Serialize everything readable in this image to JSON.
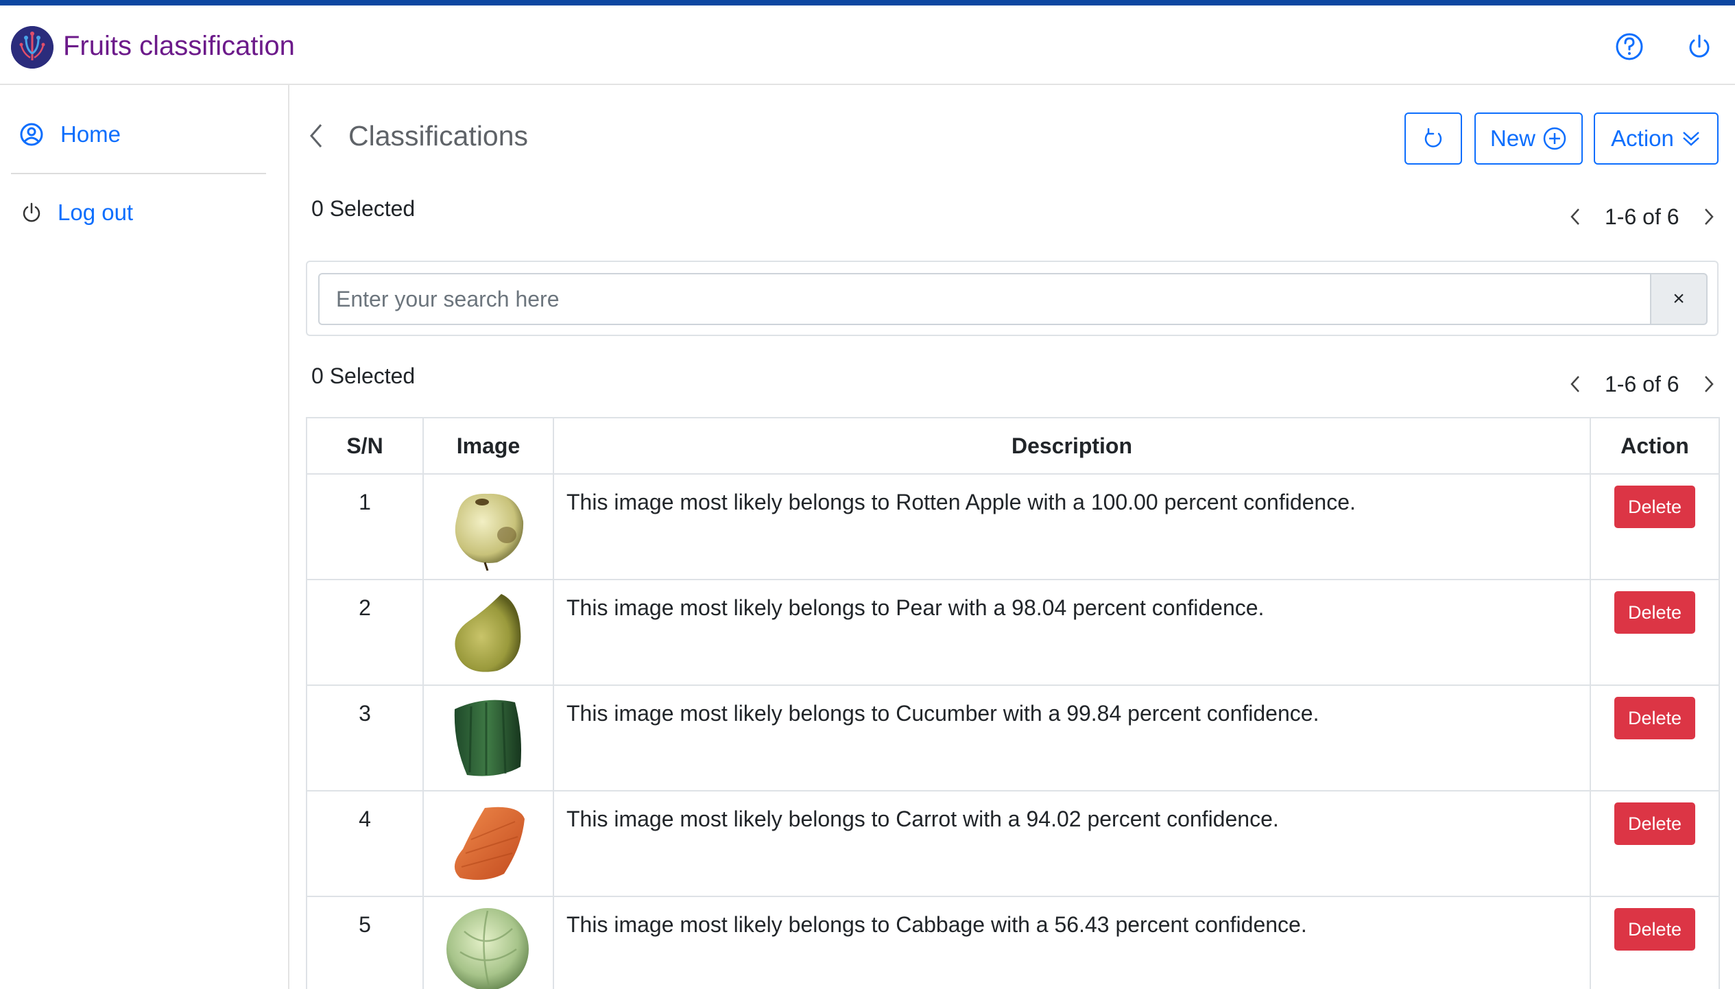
{
  "app": {
    "title": "Fruits classification"
  },
  "header": {
    "help_icon": "question-circle-icon",
    "power_icon": "power-icon"
  },
  "sidebar": {
    "items": [
      {
        "label": "Home",
        "icon": "user-circle-icon"
      },
      {
        "label": "Log out",
        "icon": "power-icon"
      }
    ]
  },
  "page": {
    "title": "Classifications"
  },
  "toolbar": {
    "new_label": "New",
    "action_label": "Action",
    "refresh_icon": "refresh-icon"
  },
  "selection": {
    "top_text": "0 Selected",
    "bottom_text": "0 Selected"
  },
  "pagination": {
    "top_text": "1-6 of 6",
    "bottom_text": "1-6 of 6"
  },
  "search": {
    "placeholder": "Enter your search here",
    "clear_label": "×"
  },
  "table": {
    "columns": [
      "S/N",
      "Image",
      "Description",
      "Action"
    ],
    "rows": [
      {
        "sn": "1",
        "image": "rotten-apple",
        "description": "This image most likely belongs to Rotten Apple with a 100.00 percent confidence.",
        "action": "Delete"
      },
      {
        "sn": "2",
        "image": "pear",
        "description": "This image most likely belongs to Pear with a 98.04 percent confidence.",
        "action": "Delete"
      },
      {
        "sn": "3",
        "image": "cucumber",
        "description": "This image most likely belongs to Cucumber with a 99.84 percent confidence.",
        "action": "Delete"
      },
      {
        "sn": "4",
        "image": "carrot",
        "description": "This image most likely belongs to Carrot with a 94.02 percent confidence.",
        "action": "Delete"
      },
      {
        "sn": "5",
        "image": "cabbage",
        "description": "This image most likely belongs to Cabbage with a 56.43 percent confidence.",
        "action": "Delete"
      }
    ]
  },
  "colors": {
    "brand_bar": "#0d47a1",
    "title_purple": "#6c1a8a",
    "primary": "#0d6efd",
    "danger": "#dc3545"
  }
}
